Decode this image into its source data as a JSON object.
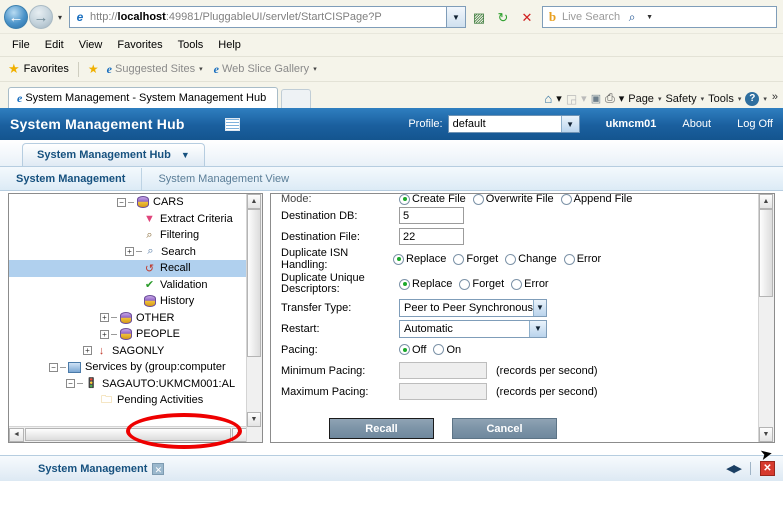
{
  "browser": {
    "back_icon": "back-arrow-icon",
    "forward_icon": "forward-arrow-icon",
    "recent_pages_caret": "▾",
    "address": {
      "favicon": "ie-page-icon",
      "prefix": "http://",
      "host": "localhost",
      "rest": ":49981/PluggableUI/servlet/StartCISPage?P",
      "dropdown_caret": "▾"
    },
    "toolbar_buttons": [
      {
        "name": "compatibility-view-icon",
        "glyph": "▨"
      },
      {
        "name": "refresh-icon",
        "glyph": "↻"
      },
      {
        "name": "stop-icon",
        "glyph": "✕"
      }
    ],
    "search": {
      "engine_glyph": "b",
      "placeholder": "Live Search",
      "go_glyph": "🔍",
      "caret": "▾"
    },
    "menu": [
      "File",
      "Edit",
      "View",
      "Favorites",
      "Tools",
      "Help"
    ],
    "favorites_bar": {
      "favorites_label": "Favorites",
      "items": [
        {
          "label": "Suggested Sites",
          "icon": "ie-icon",
          "caret": "▾"
        },
        {
          "label": "Web Slice Gallery",
          "icon": "ie-icon",
          "caret": "▾"
        }
      ]
    },
    "tab": {
      "title": "System Management - System Management Hub",
      "favicon": "ie-icon"
    },
    "command_bar": [
      {
        "name": "home-icon",
        "glyph": "⌂",
        "caret": "▾"
      },
      {
        "name": "feeds-icon",
        "glyph": "◲",
        "caret": "▾"
      },
      {
        "name": "read-mail-icon",
        "glyph": "▭",
        "caret": ""
      },
      {
        "name": "print-icon",
        "glyph": "⎙",
        "caret": "▾"
      },
      {
        "name": "page-menu",
        "glyph": "Page",
        "caret": "▾"
      },
      {
        "name": "safety-menu",
        "glyph": "Safety",
        "caret": "▾"
      },
      {
        "name": "tools-menu",
        "glyph": "Tools",
        "caret": "▾"
      },
      {
        "name": "help-menu",
        "glyph": "?",
        "caret": "▾"
      }
    ],
    "overflow_chevron": "»"
  },
  "app_header": {
    "title": "System Management Hub",
    "grid_icon": "grid-icon",
    "profile_label": "Profile:",
    "profile_value": "default",
    "profile_caret": "▾",
    "user": "ukmcm01",
    "about": "About",
    "logoff": "Log Off",
    "accent_color": "#1a5f9e"
  },
  "app_tabs": {
    "main_tab": "System Management Hub",
    "main_tab_caret": "▼",
    "subtabs": [
      {
        "label": "System Management",
        "active": true
      },
      {
        "label": "System Management View",
        "active": false
      }
    ]
  },
  "tree": {
    "nodes": [
      {
        "label": "CARS",
        "indent": 5,
        "toggle": "minus",
        "icon": "database-icon",
        "selected": false
      },
      {
        "label": "Extract Criteria",
        "indent": 7,
        "toggle": "none",
        "icon": "funnel-icon",
        "selected": false
      },
      {
        "label": "Filtering",
        "indent": 7,
        "toggle": "none",
        "icon": "filter-magnifier-icon",
        "selected": false
      },
      {
        "label": "Search",
        "indent": 6,
        "toggle": "plus",
        "icon": "magnifier-icon",
        "selected": false
      },
      {
        "label": "Recall",
        "indent": 7,
        "toggle": "none",
        "icon": "recall-icon",
        "selected": true
      },
      {
        "label": "Validation",
        "indent": 7,
        "toggle": "none",
        "icon": "validation-check-icon",
        "selected": false
      },
      {
        "label": "History",
        "indent": 7,
        "toggle": "none",
        "icon": "history-database-icon",
        "selected": false
      },
      {
        "label": "OTHER",
        "indent": 4,
        "toggle": "plus",
        "icon": "database-icon",
        "selected": false
      },
      {
        "label": "PEOPLE",
        "indent": 4,
        "toggle": "plus",
        "icon": "database-icon",
        "selected": false
      },
      {
        "label": "SAGONLY",
        "indent": 3,
        "toggle": "plus",
        "icon": "database-down-icon",
        "selected": false
      },
      {
        "label": "Services by (group:computer",
        "indent": 2,
        "toggle": "minus",
        "icon": "computer-icon",
        "selected": false
      },
      {
        "label": "SAGAUTO:UKMCM001:AL",
        "indent": 3,
        "toggle": "minus",
        "icon": "traffic-light-icon",
        "selected": false
      },
      {
        "label": "Pending Activities",
        "indent": 5,
        "toggle": "none",
        "icon": "pending-folder-icon",
        "selected": false
      }
    ],
    "scroll_up": "▲",
    "scroll_down": "▼",
    "scroll_left": "◀",
    "scroll_right": "▶"
  },
  "form": {
    "cut_row": {
      "label": "Mode:",
      "options": [
        "Create File",
        "Overwrite File",
        "Append File"
      ],
      "selected": "Create File"
    },
    "rows": [
      {
        "type": "text",
        "label": "Destination DB:",
        "value": "5",
        "disabled": false
      },
      {
        "type": "text",
        "label": "Destination File:",
        "value": "22",
        "disabled": false
      },
      {
        "type": "radio",
        "label": "Duplicate ISN Handling:",
        "options": [
          "Replace",
          "Forget",
          "Change",
          "Error"
        ],
        "selected": "Replace"
      },
      {
        "type": "radio",
        "label": "Duplicate Unique Descriptors:",
        "label_line1": "Duplicate Unique",
        "label_line2": "Descriptors:",
        "options": [
          "Replace",
          "Forget",
          "Error"
        ],
        "selected": "Replace"
      },
      {
        "type": "select",
        "label": "Transfer Type:",
        "value": "Peer to Peer Synchronous",
        "caret": "▾",
        "width": 148
      },
      {
        "type": "select",
        "label": "Restart:",
        "value": "Automatic",
        "caret": "▾",
        "width": 148
      },
      {
        "type": "radio",
        "label": "Pacing:",
        "options": [
          "Off",
          "On"
        ],
        "selected": "Off"
      },
      {
        "type": "text",
        "label": "Minimum Pacing:",
        "value": "",
        "disabled": true,
        "hint": "(records per second)"
      },
      {
        "type": "text",
        "label": "Maximum Pacing:",
        "value": "",
        "disabled": true,
        "hint": "(records per second)"
      }
    ],
    "buttons": [
      {
        "label": "Recall",
        "name": "recall-button",
        "focused": true
      },
      {
        "label": "Cancel",
        "name": "cancel-button",
        "focused": false
      }
    ],
    "annotation_color": "#ee0000",
    "scroll_up": "▲",
    "scroll_down": "▼",
    "cursor_glyph": "➤"
  },
  "bottom_bar": {
    "label": "System Management",
    "close_tab_glyph": "✕",
    "nav_prev": "◀",
    "nav_next": "▶",
    "close_glyph": "✕"
  }
}
